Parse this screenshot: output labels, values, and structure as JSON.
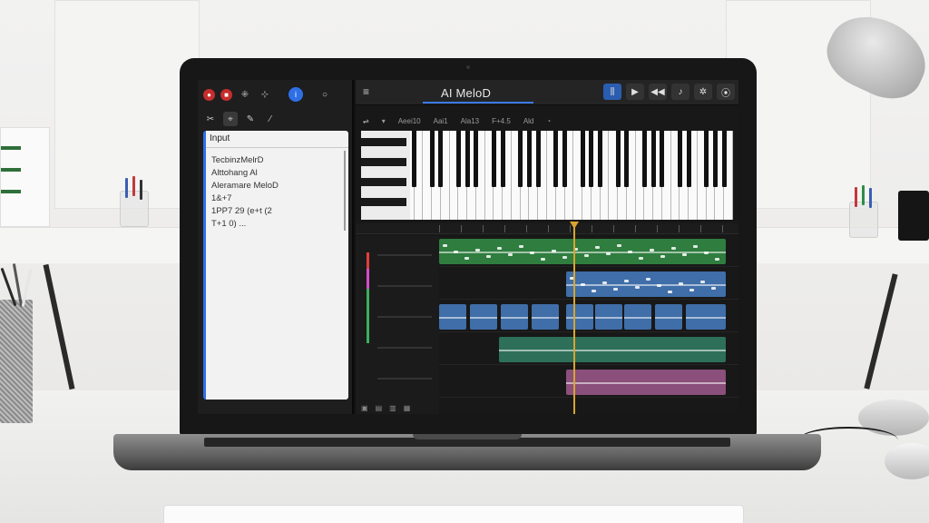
{
  "app": {
    "title": "AI MeloD",
    "menu_icon": "hamburger-icon"
  },
  "left_toolbar": {
    "row1": [
      "record-icon",
      "stop-icon",
      "grid-icon",
      "sliders-icon",
      "info-icon",
      "power-icon"
    ],
    "row2": [
      "scissors-icon",
      "select-icon",
      "pencil-icon",
      "pen-icon"
    ]
  },
  "input_panel": {
    "title": "Input",
    "lines": [
      "TecbinzMelrD",
      "Alttohang Al",
      "Aleramare MeloD",
      "1&+7",
      "1PP7 29 (e+t (2",
      "T+1 0) ..."
    ]
  },
  "transport": {
    "buttons": [
      "split-icon",
      "play-icon",
      "rewind-icon",
      "mic-icon",
      "settings-icon"
    ]
  },
  "piano_header": {
    "labels": [
      "Aeei10",
      "Aai1",
      "Ala13",
      "F+4.5",
      "Ald"
    ]
  },
  "tracks": {
    "colors": {
      "green": "#2f7d3f",
      "blue": "#3f6ea8",
      "teal": "#2e6f5a",
      "pink": "#8a4f7a",
      "playhead": "#d8a52e",
      "accent": "#3a7be8"
    },
    "rows": [
      {
        "name": "melody-track",
        "color": "green"
      },
      {
        "name": "notes-track",
        "color": "blue"
      },
      {
        "name": "vocal-wave-track",
        "color": "blue"
      },
      {
        "name": "synth-track",
        "color": "teal"
      },
      {
        "name": "pad-track",
        "color": "pink"
      }
    ]
  }
}
